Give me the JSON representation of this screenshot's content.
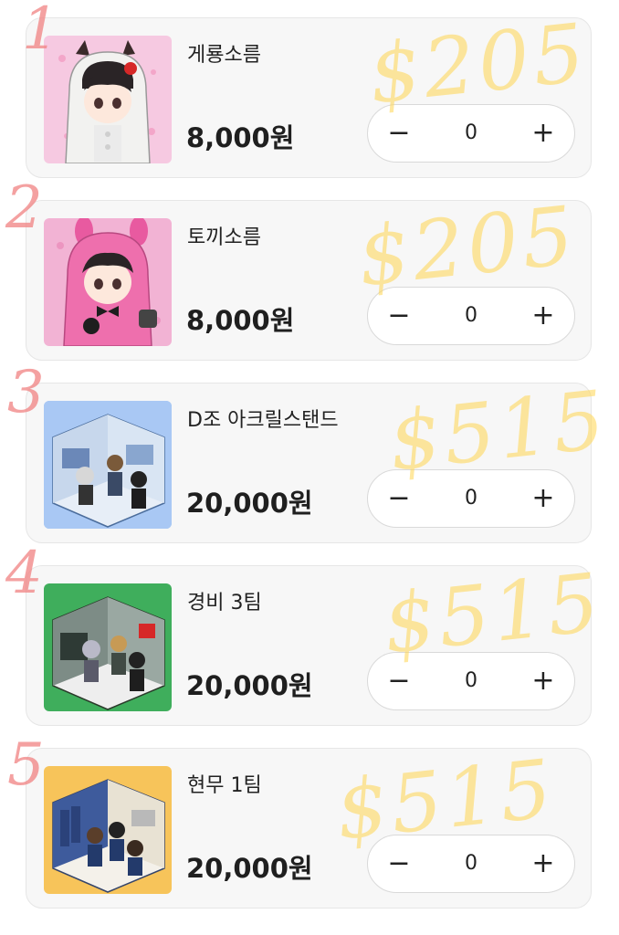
{
  "products": [
    {
      "name": "게룡소름",
      "price": "8,000원",
      "quantity": "0",
      "index_mark": "1",
      "price_note": "$205",
      "thumb_bg": "#f6c9e1"
    },
    {
      "name": "토끼소름",
      "price": "8,000원",
      "quantity": "0",
      "index_mark": "2",
      "price_note": "$205",
      "thumb_bg": "#f2b3d4"
    },
    {
      "name": "D조 아크릴스탠드",
      "price": "20,000원",
      "quantity": "0",
      "index_mark": "3",
      "price_note": "$515",
      "thumb_bg": "#8fb8ef"
    },
    {
      "name": "경비 3팀",
      "price": "20,000원",
      "quantity": "0",
      "index_mark": "4",
      "price_note": "$515",
      "thumb_bg": "#3fae5c"
    },
    {
      "name": "현무 1팀",
      "price": "20,000원",
      "quantity": "0",
      "index_mark": "5",
      "price_note": "$515",
      "thumb_bg": "#f7c45a"
    }
  ],
  "stepper": {
    "minus_icon": "minus-icon",
    "plus_icon": "plus-icon",
    "minus_glyph": "−",
    "plus_glyph": "+"
  },
  "colors": {
    "card_bg": "#f7f7f7",
    "annotation_pink": "#f08282",
    "annotation_yellow": "#ffd650"
  }
}
